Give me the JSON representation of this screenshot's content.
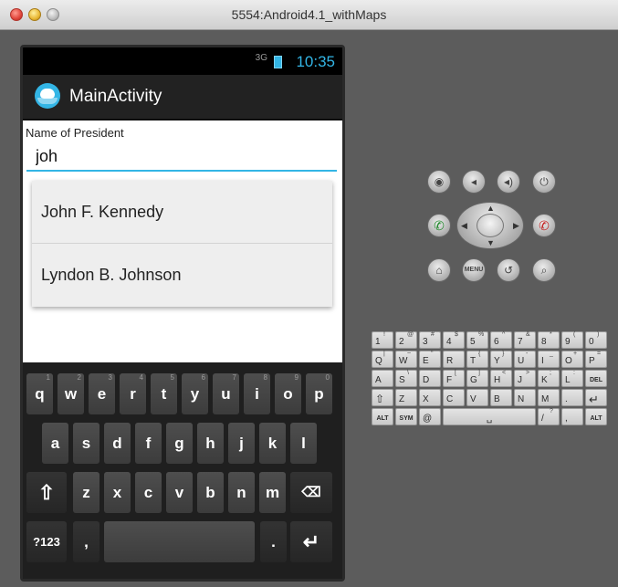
{
  "window": {
    "title": "5554:Android4.1_withMaps"
  },
  "status_bar": {
    "signal": "3G",
    "clock": "10:35"
  },
  "action_bar": {
    "title": "MainActivity"
  },
  "form": {
    "label": "Name of President",
    "input_value": "joh",
    "suggestions": [
      "John F. Kennedy",
      "Lyndon B. Johnson"
    ]
  },
  "keyboard": {
    "row1": [
      {
        "k": "q",
        "h": "1"
      },
      {
        "k": "w",
        "h": "2"
      },
      {
        "k": "e",
        "h": "3"
      },
      {
        "k": "r",
        "h": "4"
      },
      {
        "k": "t",
        "h": "5"
      },
      {
        "k": "y",
        "h": "6"
      },
      {
        "k": "u",
        "h": "7"
      },
      {
        "k": "i",
        "h": "8"
      },
      {
        "k": "o",
        "h": "9"
      },
      {
        "k": "p",
        "h": "0"
      }
    ],
    "row2": [
      "a",
      "s",
      "d",
      "f",
      "g",
      "h",
      "j",
      "k",
      "l"
    ],
    "row3": [
      "z",
      "x",
      "c",
      "v",
      "b",
      "n",
      "m"
    ],
    "symbols_key": "?123",
    "comma_key": ",",
    "period_key": "."
  },
  "controls": {
    "menu_label": "MENU",
    "icons": [
      "camera-icon",
      "volume-down-icon",
      "volume-up-icon",
      "power-icon",
      "call-icon",
      "dpad",
      "end-call-icon",
      "home-icon",
      "menu-button",
      "back-icon",
      "search-icon"
    ]
  },
  "hw_keyboard": {
    "row1": [
      {
        "k": "1",
        "s": "!"
      },
      {
        "k": "2",
        "s": "@"
      },
      {
        "k": "3",
        "s": "#"
      },
      {
        "k": "4",
        "s": "$"
      },
      {
        "k": "5",
        "s": "%"
      },
      {
        "k": "6",
        "s": "^"
      },
      {
        "k": "7",
        "s": "&"
      },
      {
        "k": "8",
        "s": "*"
      },
      {
        "k": "9",
        "s": "("
      },
      {
        "k": "0",
        "s": ")"
      }
    ],
    "row2": [
      {
        "k": "Q",
        "s": "|"
      },
      {
        "k": "W",
        "s": "~"
      },
      {
        "k": "E",
        "s": "\""
      },
      {
        "k": "R",
        "s": ""
      },
      {
        "k": "T",
        "s": "{"
      },
      {
        "k": "Y",
        "s": "}"
      },
      {
        "k": "U",
        "s": "-"
      },
      {
        "k": "I",
        "s": "_"
      },
      {
        "k": "O",
        "s": "+"
      },
      {
        "k": "P",
        "s": "="
      }
    ],
    "row3": [
      {
        "k": "A",
        "s": ""
      },
      {
        "k": "S",
        "s": "\\"
      },
      {
        "k": "D",
        "s": ""
      },
      {
        "k": "F",
        "s": "["
      },
      {
        "k": "G",
        "s": "]"
      },
      {
        "k": "H",
        "s": "<"
      },
      {
        "k": "J",
        "s": ">"
      },
      {
        "k": "K",
        "s": ";"
      },
      {
        "k": "L",
        "s": ":"
      },
      {
        "k": "DEL",
        "s": ""
      }
    ],
    "row4": [
      {
        "k": "⇧",
        "s": ""
      },
      {
        "k": "Z",
        "s": ""
      },
      {
        "k": "X",
        "s": ""
      },
      {
        "k": "C",
        "s": ""
      },
      {
        "k": "V",
        "s": ""
      },
      {
        "k": "B",
        "s": ""
      },
      {
        "k": "N",
        "s": ""
      },
      {
        "k": "M",
        "s": ""
      },
      {
        "k": ".",
        "s": ""
      },
      {
        "k": "↵",
        "s": ""
      }
    ],
    "row5": [
      {
        "k": "ALT",
        "s": ""
      },
      {
        "k": "SYM",
        "s": ""
      },
      {
        "k": "@",
        "s": ""
      },
      {
        "k": "␣",
        "s": ""
      },
      {
        "k": "/",
        "s": "?"
      },
      {
        "k": ",",
        "s": ""
      },
      {
        "k": "ALT",
        "s": ""
      }
    ]
  }
}
